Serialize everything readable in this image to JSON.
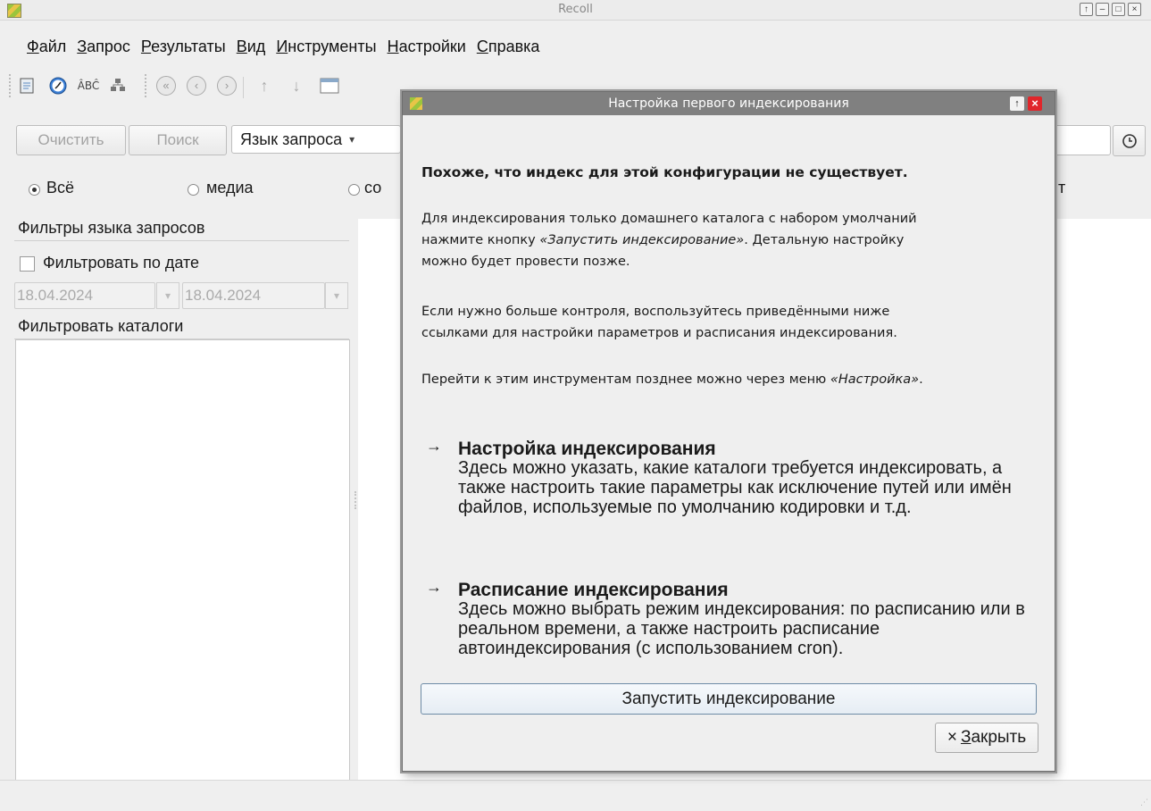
{
  "window": {
    "title": "Recoll"
  },
  "menu": [
    {
      "pre": "",
      "key": "Ф",
      "post": "айл"
    },
    {
      "pre": "",
      "key": "З",
      "post": "апрос"
    },
    {
      "pre": "",
      "key": "Р",
      "post": "езультаты"
    },
    {
      "pre": "",
      "key": "В",
      "post": "ид"
    },
    {
      "pre": "",
      "key": "И",
      "post": "нструменты"
    },
    {
      "pre": "",
      "key": "Н",
      "post": "астройки"
    },
    {
      "pre": "",
      "key": "С",
      "post": "правка"
    }
  ],
  "toolbar": {
    "spell_icon_text": "ÂBĈ"
  },
  "search": {
    "clear_label": "Очистить",
    "search_label": "Поиск",
    "query_language": "Язык запроса"
  },
  "filters": {
    "all_label": "Всё",
    "media_label": "медиа",
    "partial_label": "со",
    "partial_right_label": "т"
  },
  "left_panel": {
    "query_filters_title": "Фильтры языка запросов",
    "filter_by_date_label": "Фильтровать по дате",
    "date_from": "18.04.2024",
    "date_to": "18.04.2024",
    "filter_catalogs_title": "Фильтровать каталоги"
  },
  "dialog": {
    "title": "Настройка первого индексирования",
    "heading": "Похоже, что индекс для этой конфигурации не существует.",
    "para1_a": "Для индексирования только домашнего каталога с набором умолчаний",
    "para1_b_pre": "нажмите кнопку ",
    "para1_b_em": "«Запустить индексирование»",
    "para1_b_post": ". Детальную настройку",
    "para1_c": "можно будет провести позже.",
    "para2_a": "Если нужно больше контроля, воспользуйтесь приведёнными ниже",
    "para2_b": "ссылками для настройки параметров и расписания индексирования.",
    "para3_pre": "Перейти к этим инструментам позднее можно через меню ",
    "para3_em": "«Настройка»",
    "para3_post": ".",
    "arrow": "→",
    "link1_title": "Настройка индексирования",
    "link1_desc": "Здесь можно указать, какие каталоги требуется индексировать, а также настроить такие параметры как исключение путей или имён файлов, используемые по умолчанию кодировки и т.д.",
    "link2_title": "Расписание индексирования",
    "link2_desc": "Здесь можно выбрать режим индексирования: по расписанию или в реальном времени, а также настроить расписание автоиндексирования (с использованием cron).",
    "start_button": "Запустить индексирование",
    "close_key": "З",
    "close_rest": "акрыть",
    "close_mark": "×"
  }
}
